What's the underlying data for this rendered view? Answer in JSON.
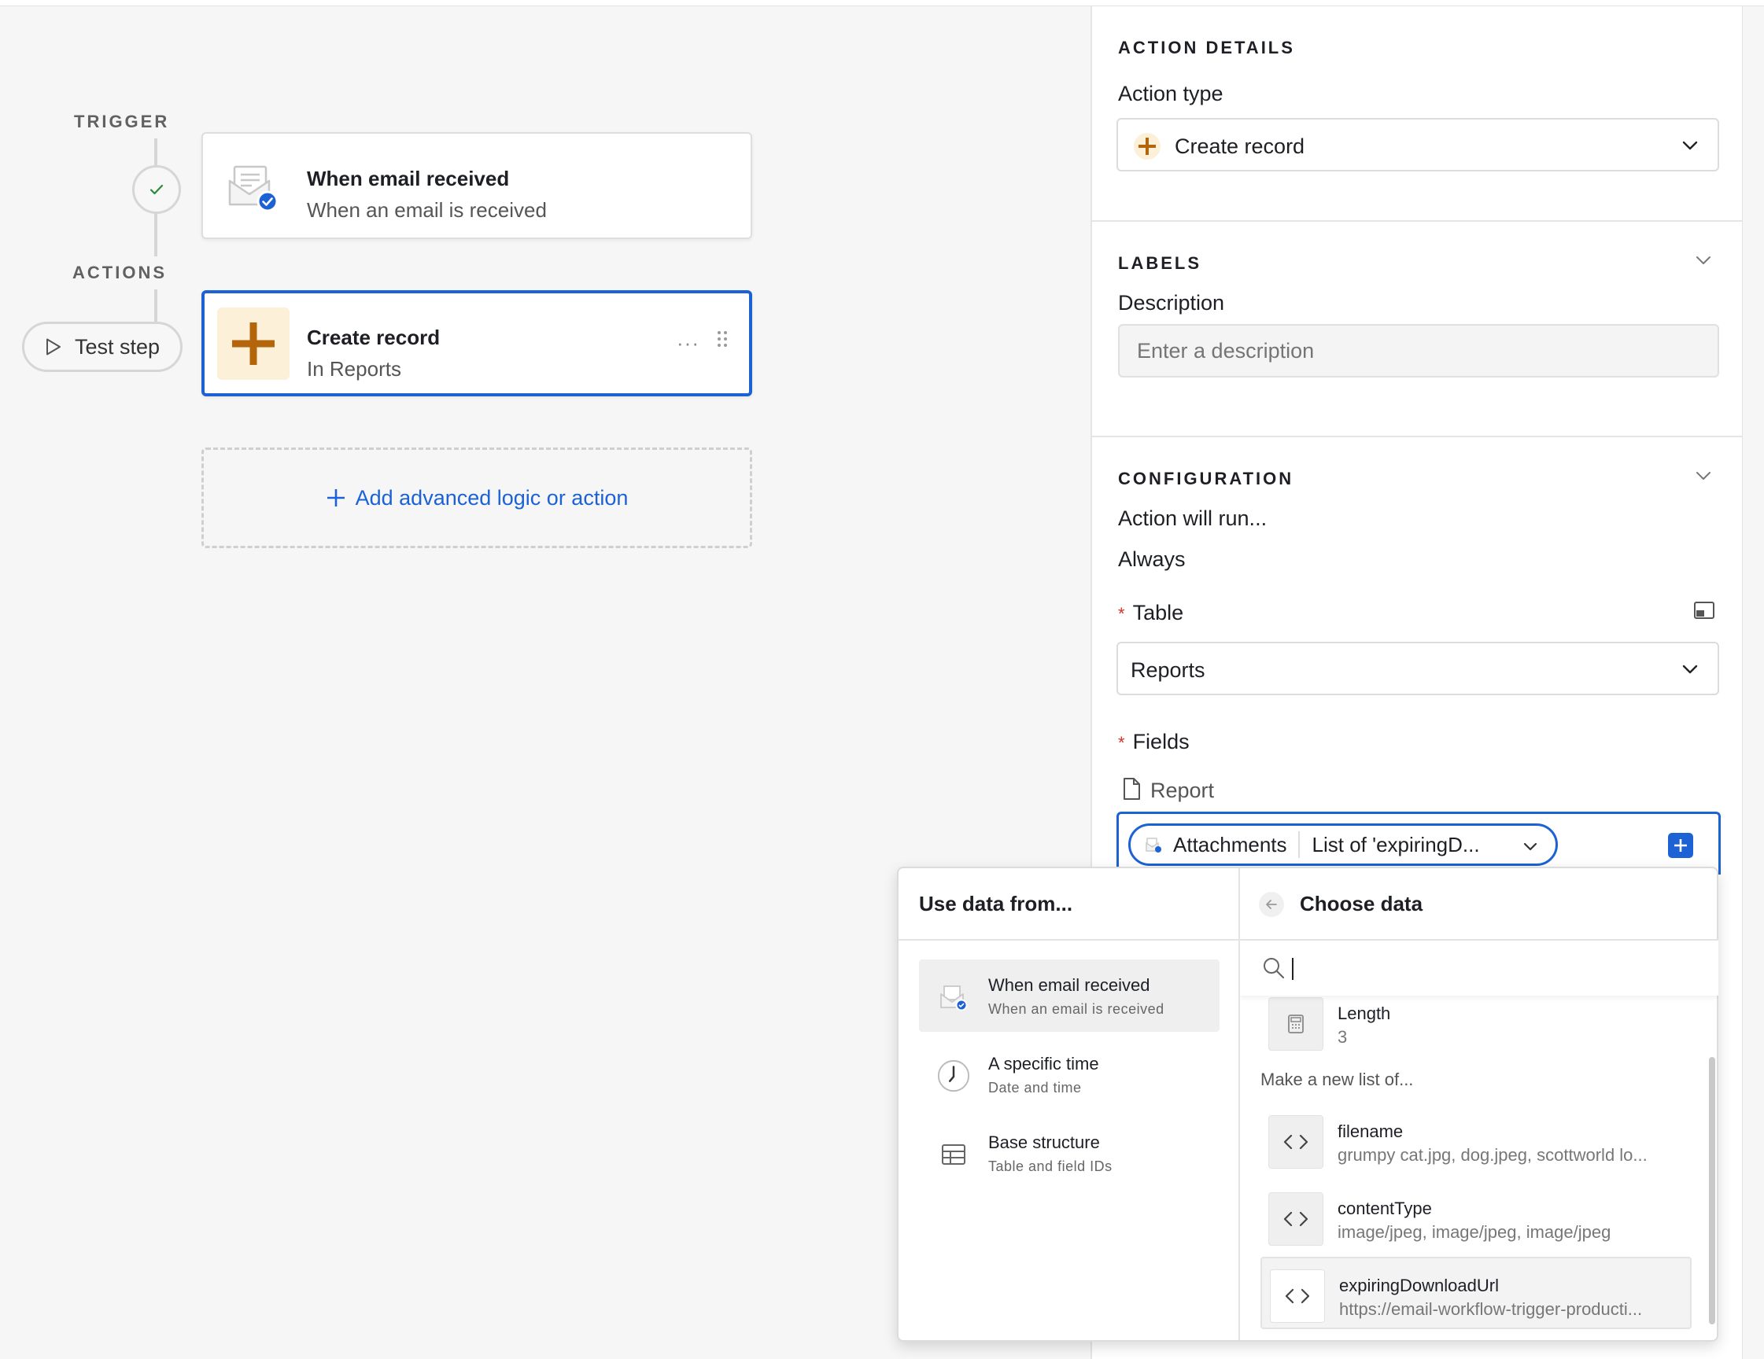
{
  "canvas": {
    "trigger_label": "TRIGGER",
    "actions_label": "ACTIONS",
    "test_step": "Test step",
    "trigger_node": {
      "title": "When email received",
      "subtitle": "When an email is received"
    },
    "action_node": {
      "title": "Create record",
      "subtitle": "In Reports",
      "more": "···"
    },
    "add_action": "Add advanced logic or action"
  },
  "panel": {
    "action_details": {
      "heading": "ACTION DETAILS",
      "action_type_label": "Action type",
      "action_type_value": "Create record"
    },
    "labels": {
      "heading": "LABELS",
      "description_label": "Description",
      "description_placeholder": "Enter a description"
    },
    "configuration": {
      "heading": "CONFIGURATION",
      "run_label": "Action will run...",
      "run_value": "Always",
      "table_label": "Table",
      "table_value": "Reports",
      "fields_label": "Fields",
      "field_name": "Report",
      "pill_source": "Attachments",
      "pill_value": "List of 'expiringD..."
    }
  },
  "popover": {
    "left_heading": "Use data from...",
    "sources": [
      {
        "title": "When email received",
        "subtitle": "When an email is received"
      },
      {
        "title": "A specific time",
        "subtitle": "Date and time"
      },
      {
        "title": "Base structure",
        "subtitle": "Table and field IDs"
      }
    ],
    "right_heading": "Choose data",
    "length_item": {
      "title": "Length",
      "value": "3"
    },
    "make_new_label": "Make a new list of...",
    "items": [
      {
        "title": "filename",
        "subtitle": "grumpy cat.jpg, dog.jpeg, scottworld lo..."
      },
      {
        "title": "contentType",
        "subtitle": "image/jpeg, image/jpeg, image/jpeg"
      },
      {
        "title": "expiringDownloadUrl",
        "subtitle": "https://email-workflow-trigger-producti..."
      }
    ]
  },
  "colors": {
    "accent": "#1c62d4",
    "action_icon": "#b4650b",
    "action_icon_bg": "#fdf0d8",
    "required": "#d0342c"
  }
}
